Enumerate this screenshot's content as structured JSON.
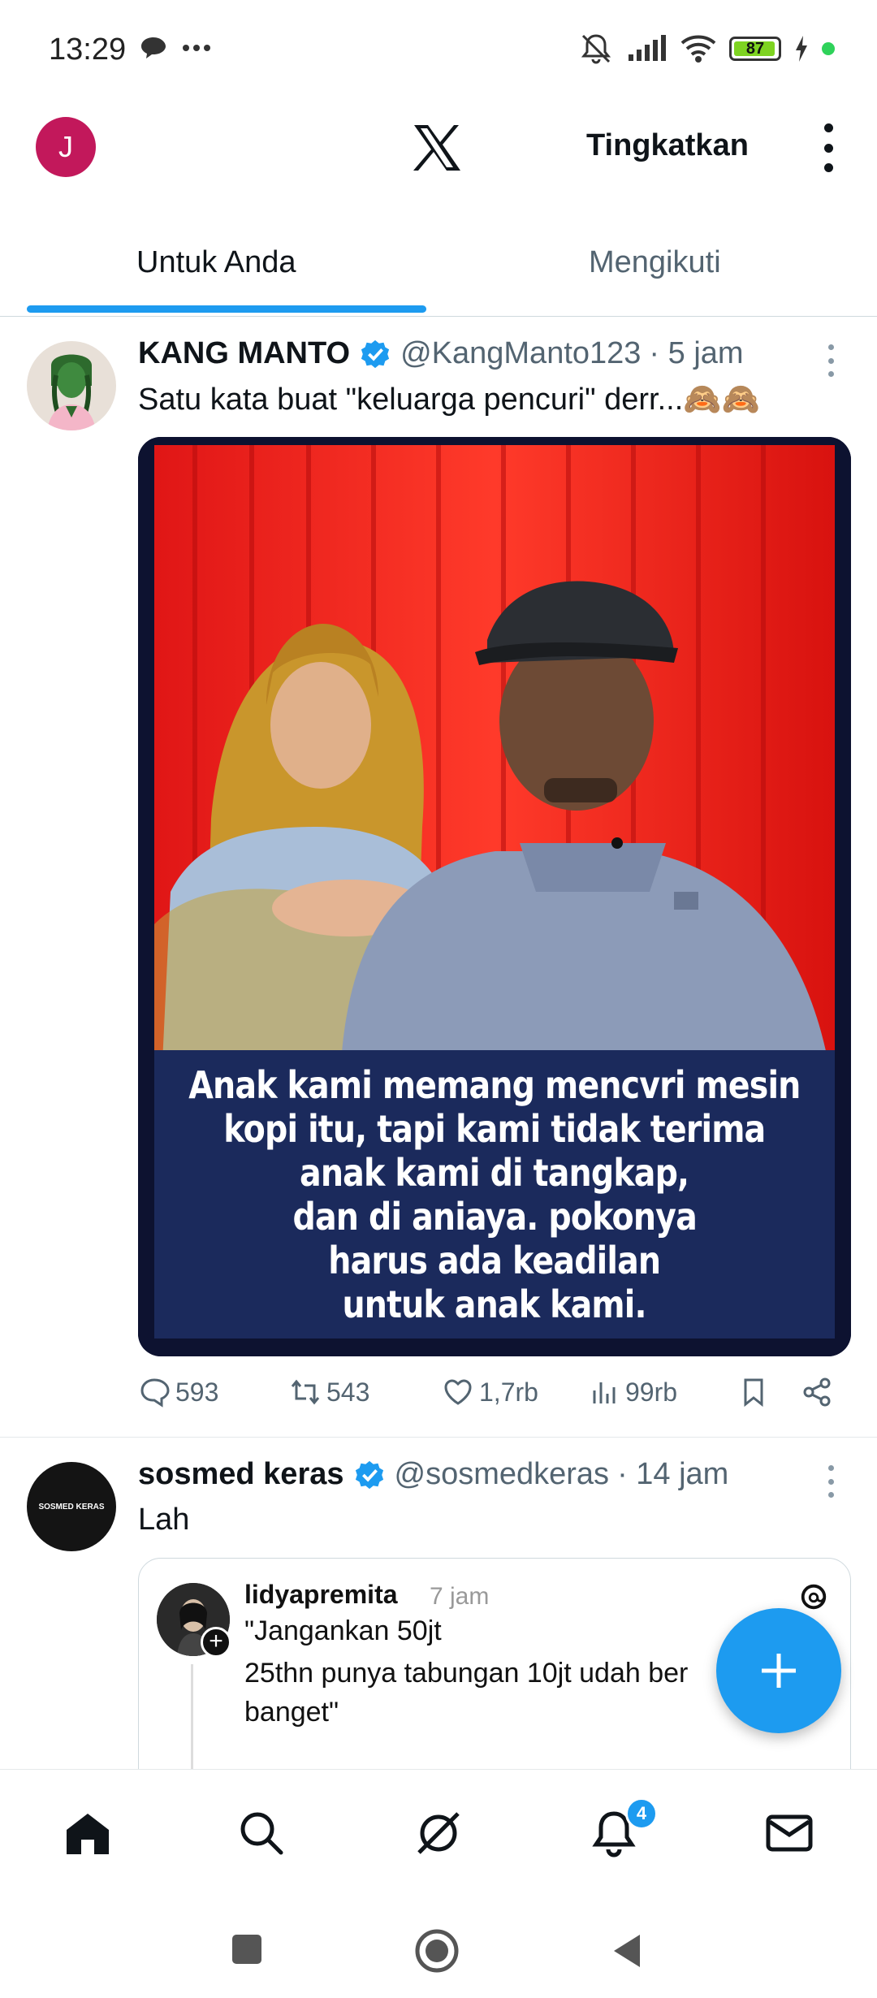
{
  "status_bar": {
    "time": "13:29",
    "battery": "87",
    "icons": [
      "chat-bubble-icon",
      "more-dots-icon",
      "mute-icon",
      "signal-icon",
      "wifi-icon",
      "battery-icon",
      "charging-icon"
    ]
  },
  "header": {
    "avatar_initial": "J",
    "logo": "x-logo",
    "upgrade_label": "Tingkatkan",
    "menu_icon": "more-vertical-icon"
  },
  "tabs": [
    {
      "label": "Untuk Anda",
      "active": true
    },
    {
      "label": "Mengikuti",
      "active": false
    }
  ],
  "accent_color": "#1d9bf0",
  "posts": [
    {
      "name": "KANG MANTO",
      "handle": "@KangManto123",
      "time": "· 5 jam",
      "text": "Satu kata buat \"keluarga pencuri\" derr...🙈🙈",
      "media_caption": [
        "Anak kami memang mencvri mesin",
        "kopi itu, tapi kami tidak terima",
        "anak kami di tangkap,",
        "dan di aniaya. pokonya",
        "harus ada keadilan",
        "untuk anak kami."
      ],
      "actions": {
        "replies": "593",
        "reposts": "543",
        "likes": "1,7rb",
        "views": "99rb"
      }
    },
    {
      "name": "sosmed keras",
      "handle": "@sosmedkeras",
      "time": "· 14 jam",
      "text": "Lah",
      "avatar_text": "SOSMED KERAS",
      "quote": {
        "user": "lidyapremita",
        "time": "7 jam",
        "lines": [
          "\"Jangankan 50jt",
          "25thn punya tabungan 10jt udah ber",
          "banget\""
        ]
      }
    }
  ],
  "bottom_nav": {
    "items": [
      "home-icon",
      "search-icon",
      "grok-icon",
      "notifications-icon",
      "messages-icon"
    ],
    "notification_count": "4"
  }
}
